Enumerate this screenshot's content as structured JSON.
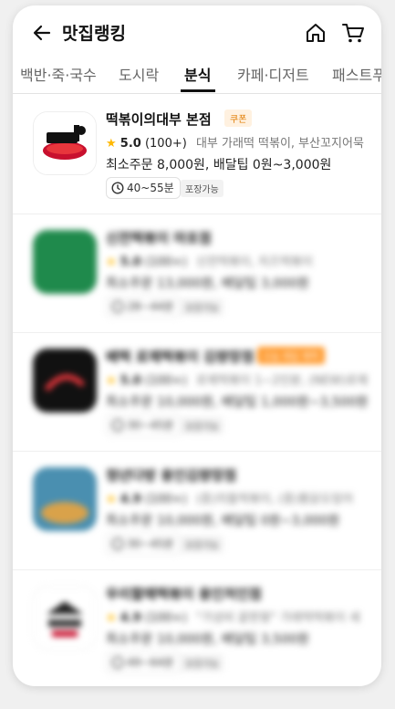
{
  "header": {
    "title": "맛집랭킹",
    "back_icon": "arrow-left-icon",
    "home_icon": "home-icon",
    "cart_icon": "cart-icon"
  },
  "tabs": [
    {
      "label": "백반·죽·국수",
      "active": false
    },
    {
      "label": "도시락",
      "active": false
    },
    {
      "label": "분식",
      "active": true
    },
    {
      "label": "카페·디저트",
      "active": false
    },
    {
      "label": "패스트푸드",
      "active": false
    }
  ],
  "stores": [
    {
      "name": "떡볶이의대부 본점",
      "badge": "쿠폰",
      "rating": "5.0",
      "review_count": "(100+)",
      "menu": "대부 가래떡 떡볶이, 부산꼬지어묵",
      "info": "최소주문 8,000원, 배달팁 0원~3,000원",
      "time": "40~55분",
      "tag": "포장가능",
      "blurred": false
    },
    {
      "name": "신전떡볶이 마포점",
      "badge": "",
      "rating": "5.0",
      "review_count": "(100+)",
      "menu": "신전떡볶이, 치즈떡볶이",
      "info": "최소주문 13,000원, 배달팁 3,000원",
      "time": "28~44분",
      "tag": "포장가능",
      "blurred": true
    },
    {
      "name": "배떡 로제떡볶이 김량장점",
      "badge": "오늘 배달 혜택",
      "rating": "5.0",
      "review_count": "(100+)",
      "menu": "로제떡볶이 1~2인분, (NEW)로제",
      "info": "최소주문 10,000원, 배달팁 1,000원~3,500원",
      "time": "30~45분",
      "tag": "포장가능",
      "blurred": true
    },
    {
      "name": "청년다방 용인김량장점",
      "badge": "",
      "rating": "4.9",
      "review_count": "(100+)",
      "menu": "(중)차돌떡볶이, (중)통닭오징어",
      "info": "최소주문 10,000원, 배달팁 0원~3,000원",
      "time": "30~45분",
      "tag": "포장가능",
      "blurred": true
    },
    {
      "name": "우리할매떡볶이 용인처인점",
      "badge": "",
      "rating": "4.9",
      "review_count": "(100+)",
      "menu": "\"가성비 끝판왕\" 가래떡떡볶이 세",
      "info": "최소주문 10,000원, 배달팁 3,500원",
      "time": "49~64분",
      "tag": "포장가능",
      "blurred": true
    }
  ],
  "colors": {
    "accent_star": "#ffb800",
    "coupon_badge_text": "#e07b00",
    "promo_badge_bg": "#ff9a2e"
  }
}
